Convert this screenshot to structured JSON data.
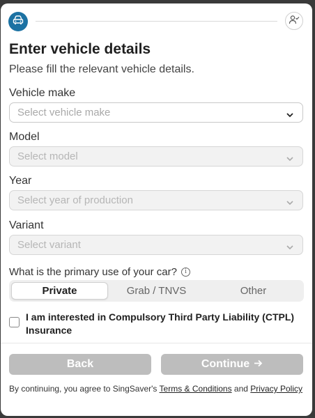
{
  "header": {
    "step_icon": "car-icon",
    "account_icon": "user-check-icon"
  },
  "page": {
    "title": "Enter vehicle details",
    "subtitle": "Please fill the relevant vehicle details."
  },
  "fields": {
    "make": {
      "label": "Vehicle make",
      "placeholder": "Select vehicle make"
    },
    "model": {
      "label": "Model",
      "placeholder": "Select model"
    },
    "year": {
      "label": "Year",
      "placeholder": "Select year of production"
    },
    "variant": {
      "label": "Variant",
      "placeholder": "Select variant"
    }
  },
  "usage": {
    "question": "What is the primary use of your car?",
    "options": [
      "Private",
      "Grab / TNVS",
      "Other"
    ],
    "selected": "Private"
  },
  "ctpl": {
    "label": "I am interested in Compulsory Third Party Liability (CTPL) Insurance",
    "checked": false
  },
  "actions": {
    "back_label": "Back",
    "continue_label": "Continue"
  },
  "footer": {
    "prefix": "By continuing, you agree to SingSaver's ",
    "terms_link": "Terms & Conditions",
    "and": " and ",
    "privacy_link": "Privacy Policy"
  },
  "colors": {
    "accent": "#1c72a3",
    "button_disabled": "#bdbdbd"
  }
}
